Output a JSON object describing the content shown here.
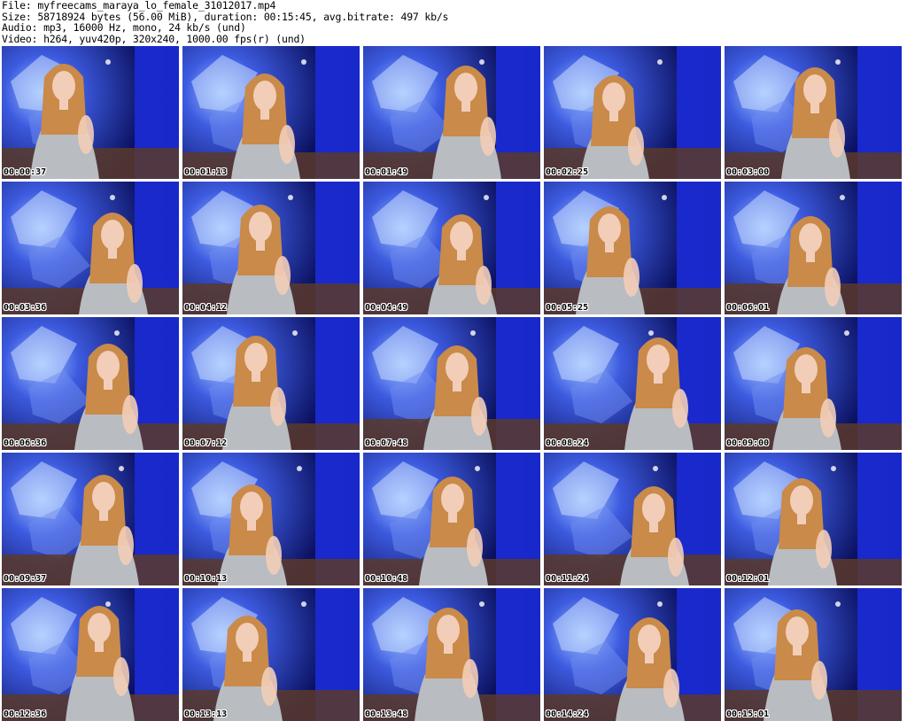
{
  "header": {
    "file": "File: myfreecams_maraya_lo_female_31012017.mp4",
    "size": "Size: 58718924 bytes (56.00 MiB), duration: 00:15:45, avg.bitrate: 497 kb/s",
    "audio": "Audio: mp3, 16000 Hz, mono, 24 kb/s (und)",
    "video": "Video: h264, yuv420p, 320x240, 1000.00 fps(r) (und)"
  },
  "thumbnails": [
    {
      "timestamp": "00:00:37"
    },
    {
      "timestamp": "00:01:13"
    },
    {
      "timestamp": "00:01:49"
    },
    {
      "timestamp": "00:02:25"
    },
    {
      "timestamp": "00:03:00"
    },
    {
      "timestamp": "00:03:36"
    },
    {
      "timestamp": "00:04:12"
    },
    {
      "timestamp": "00:04:49"
    },
    {
      "timestamp": "00:05:25"
    },
    {
      "timestamp": "00:06:01"
    },
    {
      "timestamp": "00:06:36"
    },
    {
      "timestamp": "00:07:12"
    },
    {
      "timestamp": "00:07:48"
    },
    {
      "timestamp": "00:08:24"
    },
    {
      "timestamp": "00:09:00"
    },
    {
      "timestamp": "00:09:37"
    },
    {
      "timestamp": "00:10:13"
    },
    {
      "timestamp": "00:10:48"
    },
    {
      "timestamp": "00:11:24"
    },
    {
      "timestamp": "00:12:01"
    },
    {
      "timestamp": "00:12:36"
    },
    {
      "timestamp": "00:13:13"
    },
    {
      "timestamp": "00:13:48"
    },
    {
      "timestamp": "00:14:24"
    },
    {
      "timestamp": "00:15:01"
    }
  ],
  "colors": {
    "backdrop_blue": "#1b2bd0",
    "backdrop_dark": "#0b1160",
    "skin": "#f2cdb8",
    "hair": "#c98a4a",
    "top": "#b9bcc0",
    "bed": "#5a3a2a"
  }
}
